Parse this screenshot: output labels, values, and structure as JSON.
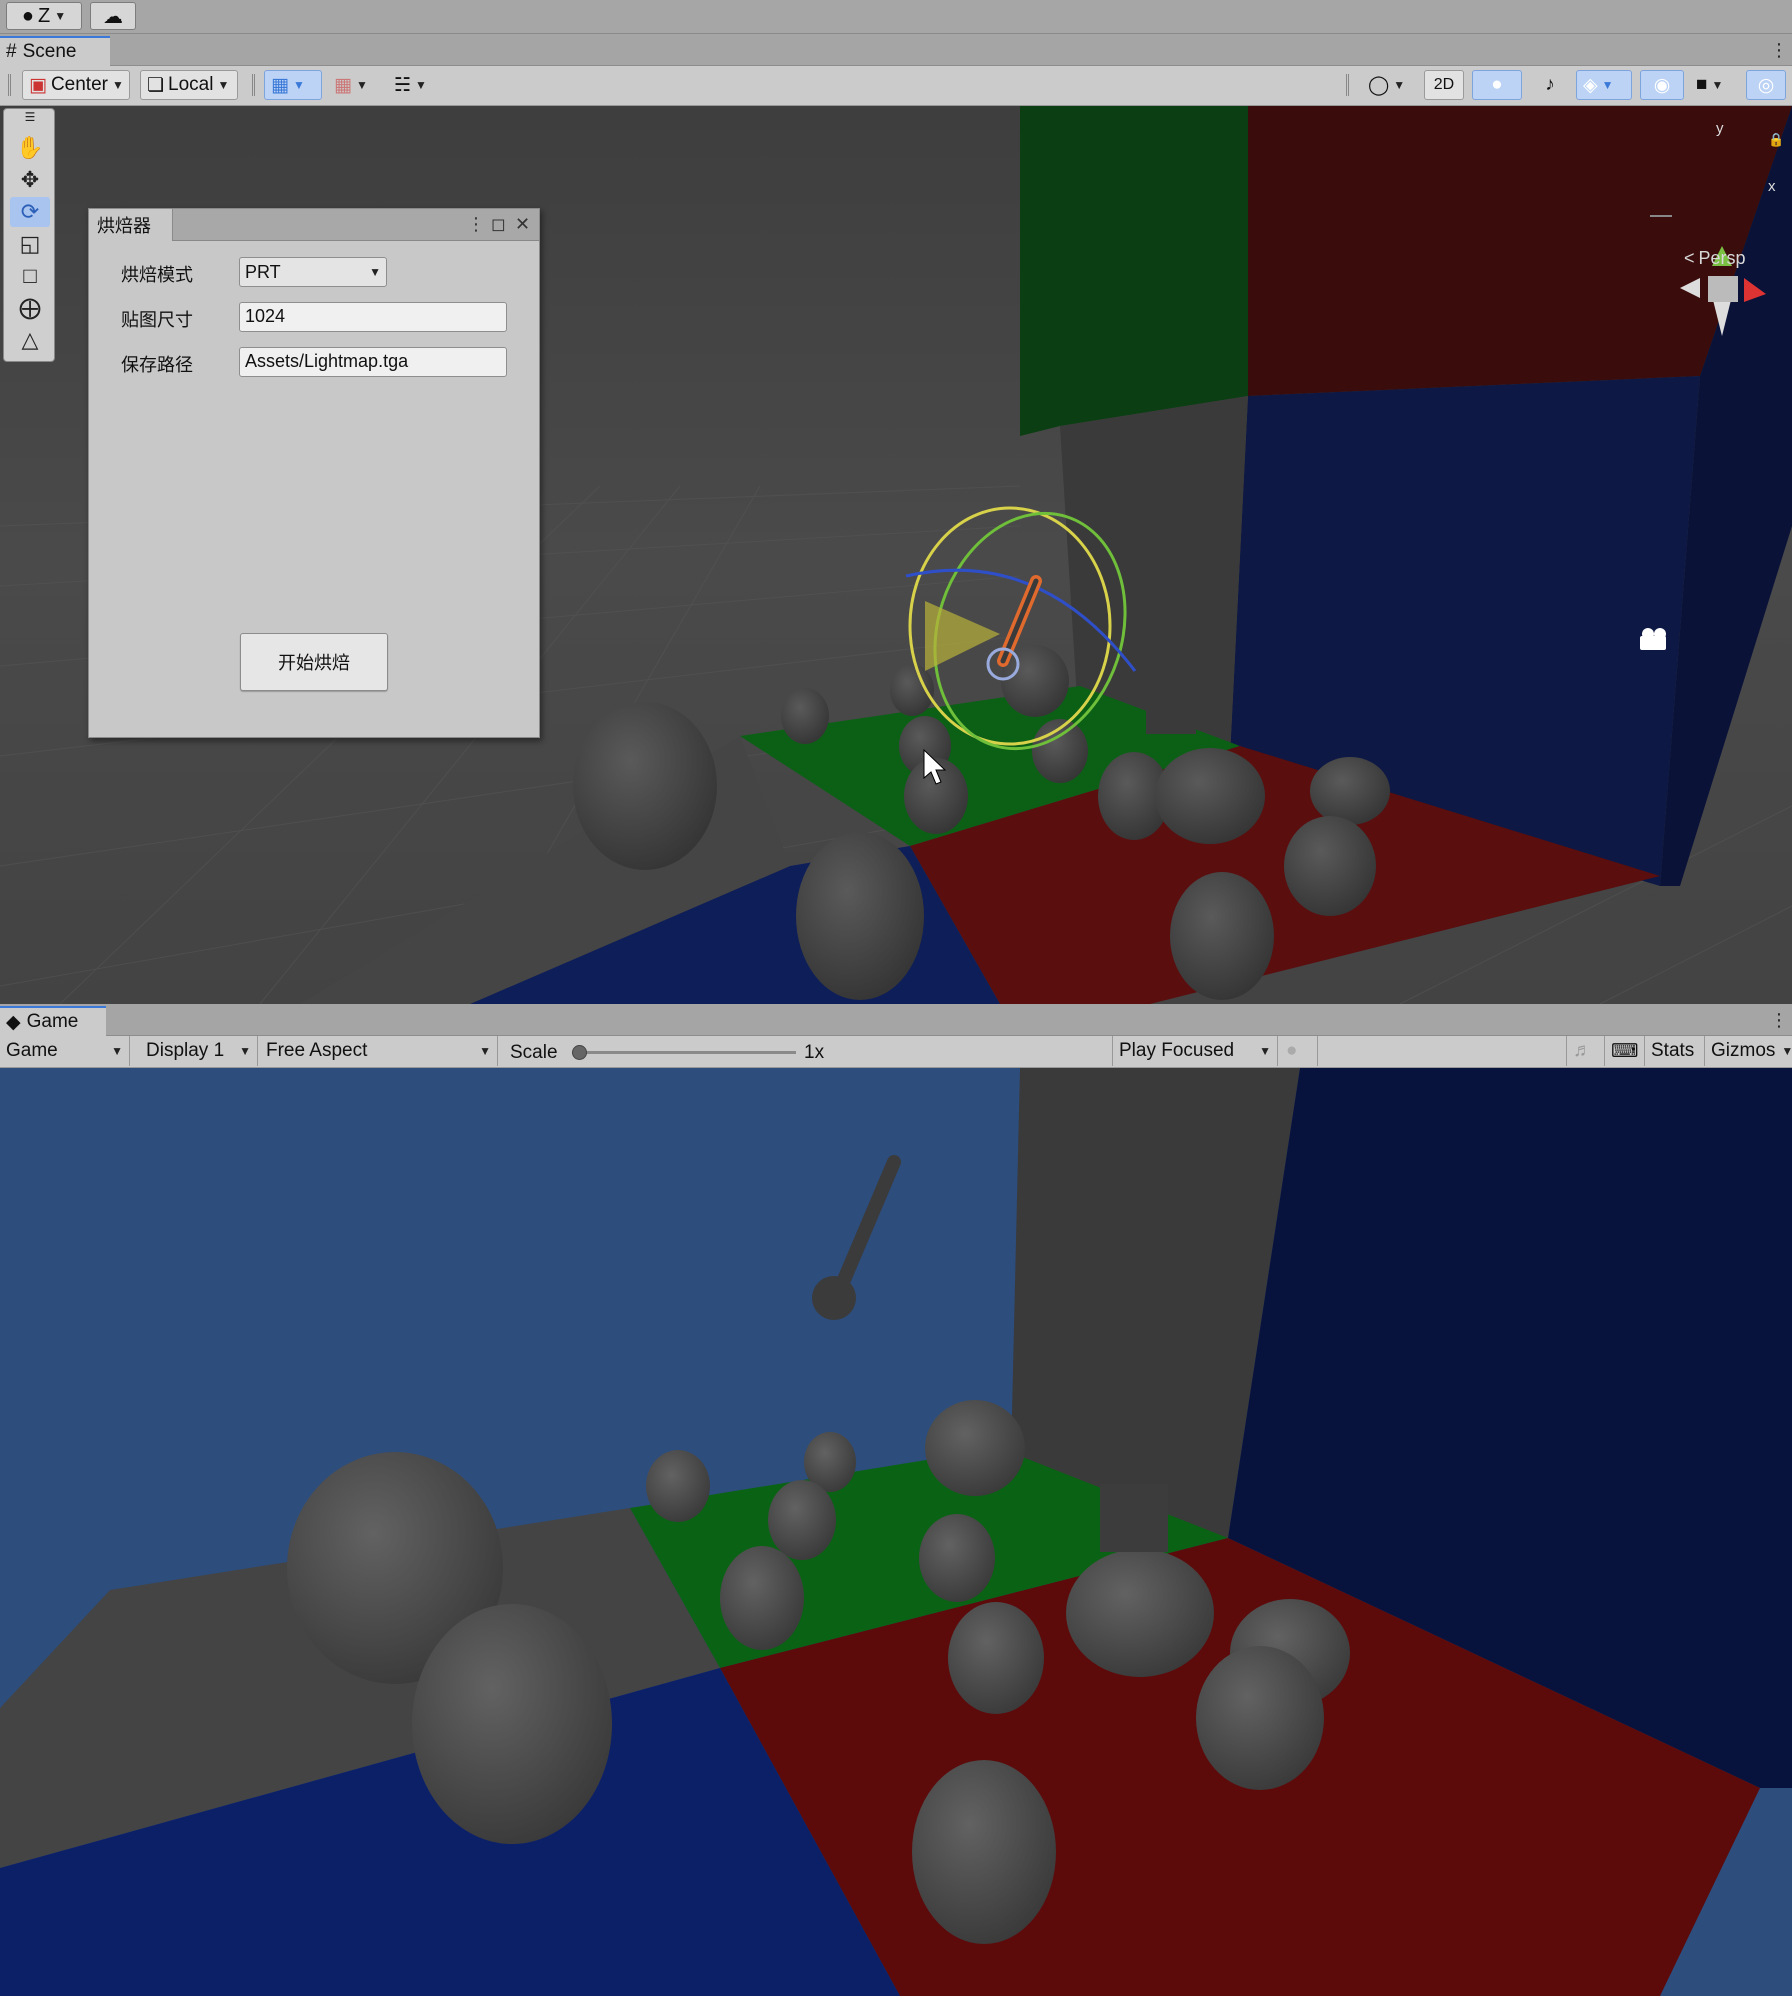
{
  "topbar": {
    "account_label": "Z",
    "account_icon": "account-icon",
    "cloud_icon": "cloud-icon"
  },
  "scene_tab": {
    "label": "Scene",
    "icon": "hash-icon"
  },
  "scene_toolbar": {
    "pivot_label": "Center",
    "space_label": "Local",
    "mode_2d_label": "2D",
    "persp_label": "Persp",
    "gizmo_axis_y": "y",
    "gizmo_axis_x": "x"
  },
  "tool_palette": {
    "items": [
      "hand-tool",
      "move-tool",
      "rotate-tool",
      "scale-tool",
      "rect-tool",
      "transform-tool",
      "custom-tool"
    ],
    "active": "rotate-tool"
  },
  "baker_window": {
    "title": "烘焙器",
    "mode_label": "烘焙模式",
    "mode_value": "PRT",
    "size_label": "贴图尺寸",
    "size_value": "1024",
    "path_label": "保存路径",
    "path_value": "Assets/Lightmap.tga",
    "bake_button": "开始烘焙"
  },
  "game_tab": {
    "label": "Game",
    "icon": "gamepad-icon"
  },
  "game_toolbar": {
    "view_label": "Game",
    "display_label": "Display 1",
    "aspect_label": "Free Aspect",
    "scale_label": "Scale",
    "scale_value": "1x",
    "scale_fraction": 0.0,
    "play_mode_label": "Play Focused",
    "stats_label": "Stats",
    "gizmos_label": "Gizmos"
  },
  "colors": {
    "floor_green": "#0f5a14",
    "floor_red": "#5a0f0f",
    "floor_blue": "#0e1e5a",
    "accent_blue": "#3a79d8",
    "gizmo_yellow": "#d8d24a"
  }
}
